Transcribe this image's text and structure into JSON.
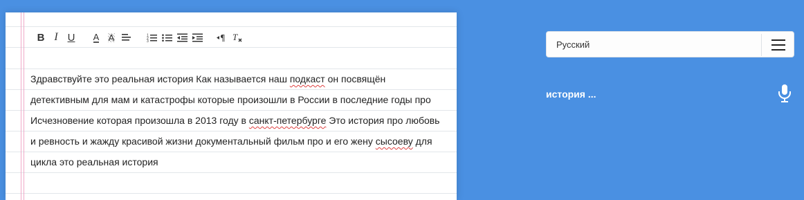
{
  "toolbar": {
    "buttons": [
      {
        "icon": "bold-icon",
        "label": "B"
      },
      {
        "icon": "italic-icon",
        "label": "I"
      },
      {
        "icon": "underline-icon",
        "label": "U"
      },
      {
        "icon": "text-color-icon",
        "label": "A"
      },
      {
        "icon": "highlight-icon",
        "label": "A"
      },
      {
        "icon": "align-icon"
      },
      {
        "icon": "ordered-list-icon"
      },
      {
        "icon": "bullet-list-icon"
      },
      {
        "icon": "outdent-icon"
      },
      {
        "icon": "indent-icon"
      },
      {
        "icon": "paragraph-direction-icon"
      },
      {
        "icon": "clear-format-icon"
      }
    ]
  },
  "editor": {
    "lines": [
      " Здравствуйте это реальная история Как называется наш ",
      "детективным для мам и катастрофы которые произошли в России в последние годы про",
      "Исчезновение которая произошла в 2013 году в ",
      "и ревность и жажду красивой жизни документальный фильм про и его жену ",
      "цикла это реальная история"
    ],
    "line1_word": "подкаст",
    "line1_tail": " он посвящён",
    "line3_word": "санкт-петербурге",
    "line3_tail": " Это история про любовь",
    "line4_word": "сысоеву",
    "line4_tail": " для"
  },
  "language": {
    "selected": "Русский"
  },
  "status": {
    "text": "история ..."
  },
  "colors": {
    "background": "#4a90e2",
    "paper": "#ffffff",
    "margin_line": "#f0a8c8",
    "spellcheck": "#e04040"
  },
  "icons": {
    "menu": "hamburger-menu-icon",
    "mic": "microphone-icon"
  }
}
